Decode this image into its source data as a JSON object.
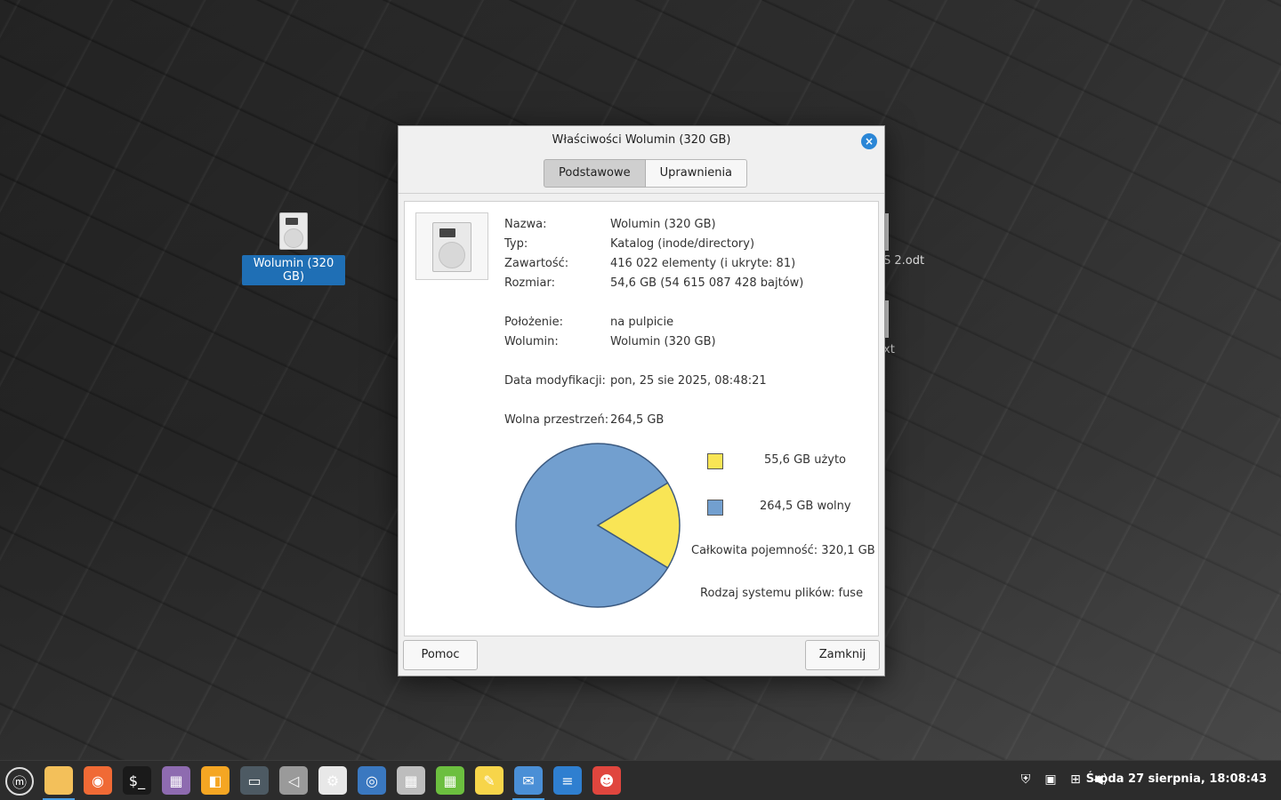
{
  "desktop": {
    "icons": [
      {
        "label": "Wolumin (320 GB)"
      }
    ],
    "peek_labels": [
      "S 2.odt",
      "xt"
    ]
  },
  "dialog": {
    "title": "Właściwości Wolumin (320 GB)",
    "close_icon": "×",
    "tabs": [
      {
        "label": "Podstawowe",
        "active": true
      },
      {
        "label": "Uprawnienia",
        "active": false
      }
    ],
    "properties": {
      "name_label": "Nazwa:",
      "name_value": "Wolumin (320 GB)",
      "type_label": "Typ:",
      "type_value": "Katalog (inode/directory)",
      "contents_label": "Zawartość:",
      "contents_value": "416 022 elementy (i ukryte: 81)",
      "size_label": "Rozmiar:",
      "size_value": "54,6 GB (54 615 087 428 bajtów)",
      "location_label": "Położenie:",
      "location_value": "na pulpicie",
      "volume_label": "Wolumin:",
      "volume_value": "Wolumin (320 GB)",
      "modified_label": "Data modyfikacji:",
      "modified_value": "pon, 25 sie 2025, 08:48:21",
      "free_label": "Wolna przestrzeń:",
      "free_value": "264,5 GB"
    },
    "usage": {
      "used_label": "55,6 GB użyto",
      "free_label": "264,5 GB wolny",
      "total_label": "Całkowita pojemność: 320,1 GB",
      "fs_label": "Rodzaj systemu plików: fuse",
      "used_gb": 55.6,
      "free_gb": 264.5,
      "used_color": "#f9e555",
      "free_color": "#729fcf"
    },
    "buttons": {
      "help": "Pomoc",
      "close": "Zamknij"
    }
  },
  "taskbar": {
    "apps": [
      {
        "name": "menu-icon",
        "glyph": "ⓜ",
        "color": "#2c2c2c"
      },
      {
        "name": "files-icon",
        "glyph": "",
        "color": "#f3c05a",
        "active": true
      },
      {
        "name": "firefox-icon",
        "glyph": "◉",
        "color": "#f06a35"
      },
      {
        "name": "terminal-icon",
        "glyph": "$_",
        "color": "#1a1a1a"
      },
      {
        "name": "mintinstall-icon",
        "glyph": "▦",
        "color": "#8e6bb0"
      },
      {
        "name": "libreoffice-icon",
        "glyph": "◧",
        "color": "#f5a623"
      },
      {
        "name": "display-icon",
        "glyph": "▭",
        "color": "#4d5a63"
      },
      {
        "name": "sound-icon",
        "glyph": "◁",
        "color": "#9a9a9a"
      },
      {
        "name": "settings-icon",
        "glyph": "⚙",
        "color": "#e8e8e8"
      },
      {
        "name": "screenshot-icon",
        "glyph": "◎",
        "color": "#3a78c0"
      },
      {
        "name": "apps-icon",
        "glyph": "▦",
        "color": "#bdbdbd"
      },
      {
        "name": "calc-icon",
        "glyph": "▦",
        "color": "#6cbf3f"
      },
      {
        "name": "notes-icon",
        "glyph": "✎",
        "color": "#f7d54a"
      },
      {
        "name": "mail-icon",
        "glyph": "✉",
        "color": "#4a8fd6",
        "active": true
      },
      {
        "name": "writer-icon",
        "glyph": "≡",
        "color": "#2f7fd0"
      },
      {
        "name": "gimp-icon",
        "glyph": "☻",
        "color": "#e0463e"
      }
    ],
    "clock": "Środa 27 sierpnia, 18:08:43"
  }
}
